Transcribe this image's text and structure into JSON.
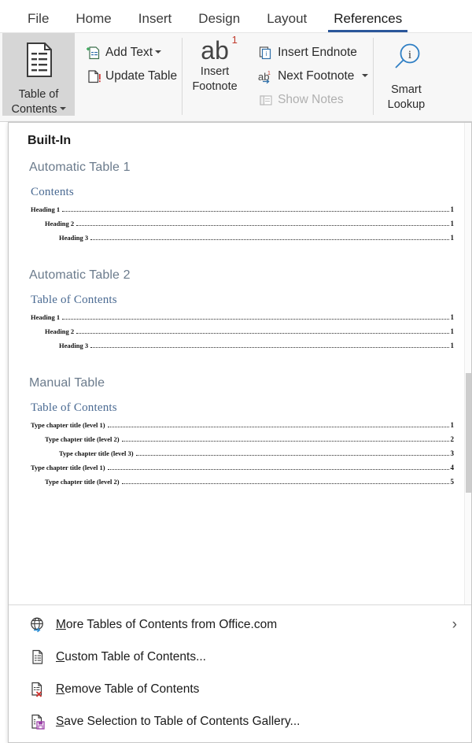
{
  "ribbon_tabs": [
    {
      "label": "File",
      "active": false
    },
    {
      "label": "Home",
      "active": false
    },
    {
      "label": "Insert",
      "active": false
    },
    {
      "label": "Design",
      "active": false
    },
    {
      "label": "Layout",
      "active": false
    },
    {
      "label": "References",
      "active": true
    }
  ],
  "ribbon": {
    "toc_button": {
      "line1": "Table of",
      "line2": "Contents",
      "icon": "table-of-contents-icon",
      "state": "pressed"
    },
    "commands": [
      {
        "label": "Add Text",
        "icon": "add-text-icon",
        "has_dropdown": true,
        "disabled": false
      },
      {
        "label": "Update Table",
        "icon": "update-table-icon",
        "has_dropdown": false,
        "disabled": false
      }
    ],
    "insert_footnote": {
      "glyph": "ab",
      "superscript": "1",
      "line1": "Insert",
      "line2": "Footnote",
      "icon": "insert-footnote-icon"
    },
    "footnote_commands": [
      {
        "label": "Insert Endnote",
        "icon": "insert-endnote-icon",
        "has_dropdown": false,
        "disabled": false
      },
      {
        "label": "Next Footnote",
        "icon": "next-footnote-icon",
        "has_dropdown": true,
        "disabled": false
      },
      {
        "label": "Show Notes",
        "icon": "show-notes-icon",
        "has_dropdown": false,
        "disabled": true
      }
    ],
    "smart_lookup": {
      "line1": "Smart",
      "line2": "Lookup",
      "icon": "smart-lookup-icon"
    }
  },
  "gallery": {
    "group_title": "Built-In",
    "entries": [
      {
        "name": "Automatic Table 1",
        "preview_heading": "Contents",
        "rows": [
          {
            "text": "Heading 1",
            "page": "1",
            "level": 1
          },
          {
            "text": "Heading 2",
            "page": "1",
            "level": 2
          },
          {
            "text": "Heading 3",
            "page": "1",
            "level": 3
          }
        ]
      },
      {
        "name": "Automatic Table 2",
        "preview_heading": "Table of Contents",
        "rows": [
          {
            "text": "Heading 1",
            "page": "1",
            "level": 1
          },
          {
            "text": "Heading 2",
            "page": "1",
            "level": 2
          },
          {
            "text": "Heading 3",
            "page": "1",
            "level": 3
          }
        ]
      },
      {
        "name": "Manual Table",
        "preview_heading": "Table of Contents",
        "rows": [
          {
            "text": "Type chapter title (level 1)",
            "page": "1",
            "level": 1
          },
          {
            "text": "Type chapter title (level 2)",
            "page": "2",
            "level": 2
          },
          {
            "text": "Type chapter title (level 3)",
            "page": "3",
            "level": 3
          },
          {
            "text": "Type chapter title (level 1)",
            "page": "4",
            "level": 1
          },
          {
            "text": "Type chapter title (level 2)",
            "page": "5",
            "level": 2
          }
        ]
      }
    ]
  },
  "menu_items": [
    {
      "accel": "M",
      "rest": "ore Tables of Contents from Office.com",
      "icon": "office-online-globe-icon",
      "submenu": true,
      "arrow": "›"
    },
    {
      "accel": "C",
      "rest": "ustom Table of Contents...",
      "icon": "custom-toc-icon",
      "submenu": false,
      "arrow": ""
    },
    {
      "accel": "R",
      "rest": "emove Table of Contents",
      "icon": "remove-toc-icon",
      "submenu": false,
      "arrow": ""
    },
    {
      "accel": "S",
      "rest": "ave Selection to Table of Contents Gallery...",
      "icon": "save-to-gallery-icon",
      "submenu": false,
      "arrow": ""
    }
  ],
  "colors": {
    "accent": "#2b579a",
    "toc_heading": "#4a6a92",
    "gallery_entry_title": "#6b7b8c",
    "pressed_button": "#d6d6d6",
    "ribbon_bg": "#f7f7f7"
  }
}
